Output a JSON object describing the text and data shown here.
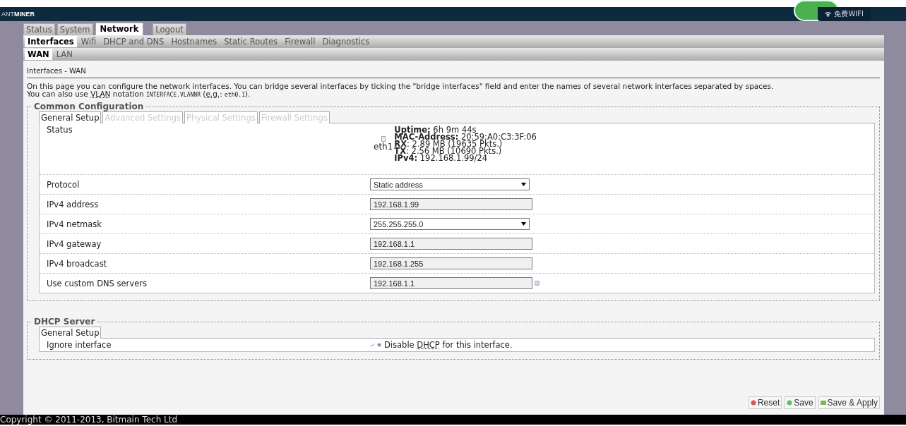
{
  "header": {
    "logo": "ANT**MINER**",
    "wifi_badge": "免费WIFI"
  },
  "tabs": [
    {
      "label": "Status",
      "selected": false
    },
    {
      "label": "System",
      "selected": false
    },
    {
      "label": "Network",
      "selected": true
    },
    {
      "label": "Logout",
      "selected": false
    }
  ],
  "subtabs": [
    {
      "label": "Interfaces",
      "selected": true
    },
    {
      "label": "Wifi",
      "selected": false
    },
    {
      "label": "DHCP and DNS",
      "selected": false
    },
    {
      "label": "Hostnames",
      "selected": false
    },
    {
      "label": "Static Routes",
      "selected": false
    },
    {
      "label": "Firewall",
      "selected": false
    },
    {
      "label": "Diagnostics",
      "selected": false
    }
  ],
  "interface_tabs": [
    {
      "label": "WAN",
      "selected": true
    },
    {
      "label": "LAN",
      "selected": false
    }
  ],
  "page_title": "Interfaces - WAN",
  "intro": "On this page you can configure the network interfaces. You can bridge several interfaces by ticking the \"bridge interfaces\" field and enter the names of several network interfaces separated by spaces.",
  "notation": [
    {
      "kind": "text",
      "text": "You can also use "
    },
    {
      "kind": "abbr",
      "text": "VLAN"
    },
    {
      "kind": "text",
      "text": " notation "
    },
    {
      "kind": "code",
      "text": "INTERFACE.VLANNR"
    },
    {
      "kind": "text",
      "text": " ("
    },
    {
      "kind": "abbr",
      "text": "e.g."
    },
    {
      "kind": "text",
      "text": ": "
    },
    {
      "kind": "code",
      "text": "eth0.1"
    },
    {
      "kind": "text",
      "text": ")."
    }
  ],
  "common": {
    "legend": "Common Configuration",
    "tabs": [
      {
        "label": "General Setup",
        "selected": true
      },
      {
        "label": "Advanced Settings",
        "selected": false
      },
      {
        "label": "Physical Settings",
        "selected": false
      },
      {
        "label": "Firewall Settings",
        "selected": false
      }
    ],
    "status": {
      "label": "Status",
      "device": "eth1",
      "lines": [
        "**Uptime:** 6h 9m 44s",
        "**MAC-Address:** 20:59:A0:C3:3F:06",
        "**RX**: 2.89 MB (19635 Pkts.)",
        "**TX**: 2.56 MB (10690 Pkts.)",
        "**IPv4:** 192.168.1.99/24"
      ]
    },
    "fields": [
      {
        "label": "Protocol",
        "kind": "select",
        "value": "Static address"
      },
      {
        "label": "IPv4 address",
        "kind": "input",
        "value": "192.168.1.99"
      },
      {
        "label": "IPv4 netmask",
        "kind": "select",
        "value": "255.255.255.0"
      },
      {
        "label": "IPv4 gateway",
        "kind": "input",
        "value": "192.168.1.1"
      },
      {
        "label": "IPv4 broadcast",
        "kind": "input",
        "value": "192.168.1.255"
      },
      {
        "label": "Use custom DNS servers",
        "kind": "dynlist",
        "value": "192.168.1.1"
      }
    ]
  },
  "dhcp": {
    "legend": "DHCP Server",
    "tabs": [
      {
        "label": "General Setup",
        "selected": true
      }
    ],
    "option": {
      "label": "Ignore interface",
      "parts": [
        {
          "kind": "text",
          "text": "Disable "
        },
        {
          "kind": "abbr",
          "text": "DHCP"
        },
        {
          "kind": "text",
          "text": " for this interface."
        }
      ]
    }
  },
  "buttons": [
    {
      "label": "Reset",
      "kind": "reset"
    },
    {
      "label": "Save",
      "kind": "save"
    },
    {
      "label": "Save & Apply",
      "kind": "apply"
    }
  ],
  "footer": "Copyright © 2011-2013, Bitmain Tech Ltd"
}
